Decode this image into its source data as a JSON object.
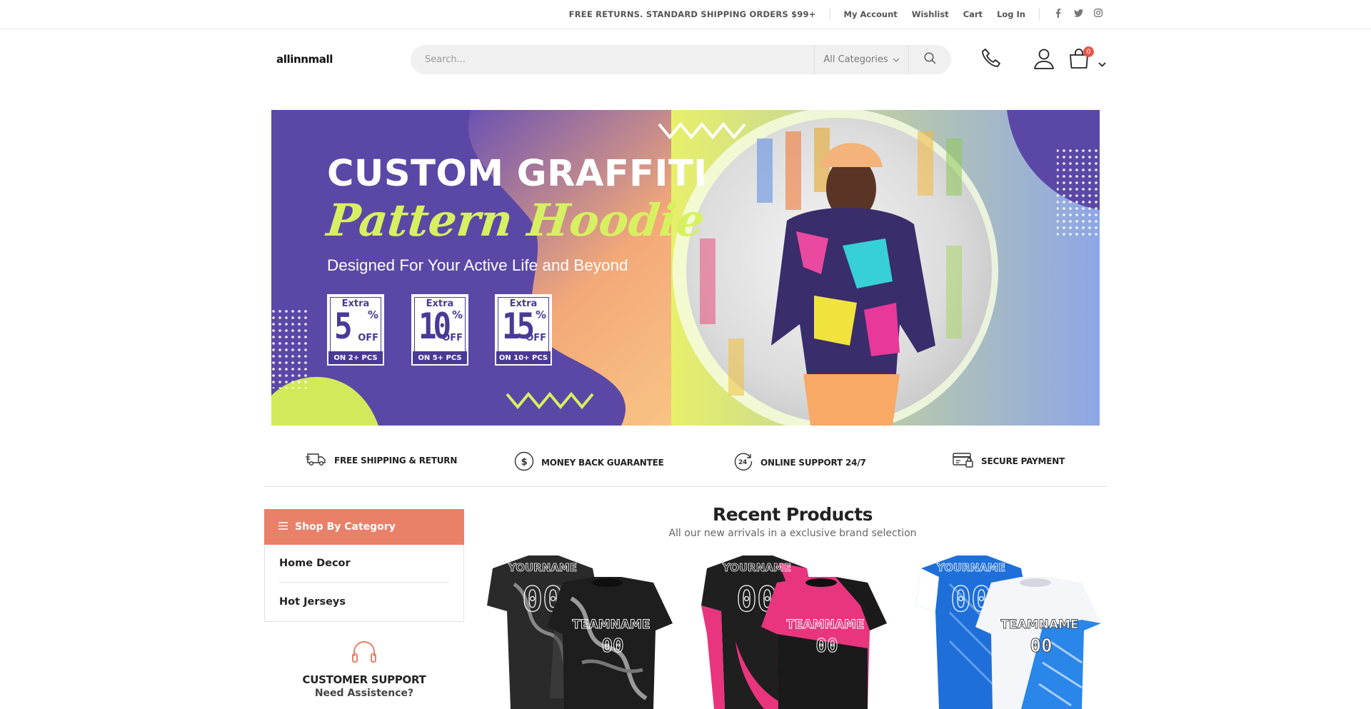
{
  "topbar": {
    "promo": "FREE RETURNS. STANDARD SHIPPING ORDERS $99+",
    "links": [
      "My Account",
      "Wishlist",
      "Cart",
      "Log In"
    ],
    "social_icons": [
      "facebook-icon",
      "twitter-icon",
      "instagram-icon"
    ]
  },
  "header": {
    "logo": "allinnmall",
    "search_placeholder": "Search...",
    "category_select": "All Categories",
    "cart_count": "0"
  },
  "banner": {
    "title": "CUSTOM GRAFFITI",
    "script": "Pattern Hoodie",
    "subtitle": "Designed For Your Active Life and Beyond",
    "coupons": [
      {
        "extra": "Extra",
        "value": "5",
        "pct": "%",
        "off": "OFF",
        "note": "ON 2+ PCS"
      },
      {
        "extra": "Extra",
        "value": "10",
        "pct": "%",
        "off": "OFF",
        "note": "ON 5+ PCS"
      },
      {
        "extra": "Extra",
        "value": "15",
        "pct": "%",
        "off": "OFF",
        "note": "ON 10+ PCS"
      }
    ]
  },
  "features": [
    {
      "label": "FREE SHIPPING & RETURN",
      "icon": "truck-icon"
    },
    {
      "label": "MONEY BACK GUARANTEE",
      "icon": "dollar-icon"
    },
    {
      "label": "ONLINE SUPPORT 24/7",
      "icon": "support-24-icon"
    },
    {
      "label": "SECURE PAYMENT",
      "icon": "payment-icon"
    }
  ],
  "sidebar": {
    "heading": "Shop By Category",
    "categories": [
      "Home Decor",
      "Hot Jerseys"
    ],
    "support_title": "CUSTOMER SUPPORT",
    "support_sub": "Need Assistence?"
  },
  "recent": {
    "title": "Recent Products",
    "subtitle": "All our new arrivals in a exclusive brand selection",
    "products": [
      {
        "name": "YOURNAME",
        "team": "TEAMNAME",
        "number": "00",
        "color": "#2a2a2a",
        "accent": "#ffffff"
      },
      {
        "name": "YOURNAME",
        "team": "TEAMNAME",
        "number": "00",
        "color": "#1f1f1f",
        "accent": "#e8357e"
      },
      {
        "name": "YOURNAME",
        "team": "TEAMNAME",
        "number": "00",
        "color": "#1e6fd9",
        "accent": "#ffffff"
      }
    ]
  },
  "colors": {
    "accent": "#e98068",
    "banner_purple": "#5b48a6",
    "banner_lime": "#d7f061",
    "badge": "#e7564a"
  }
}
